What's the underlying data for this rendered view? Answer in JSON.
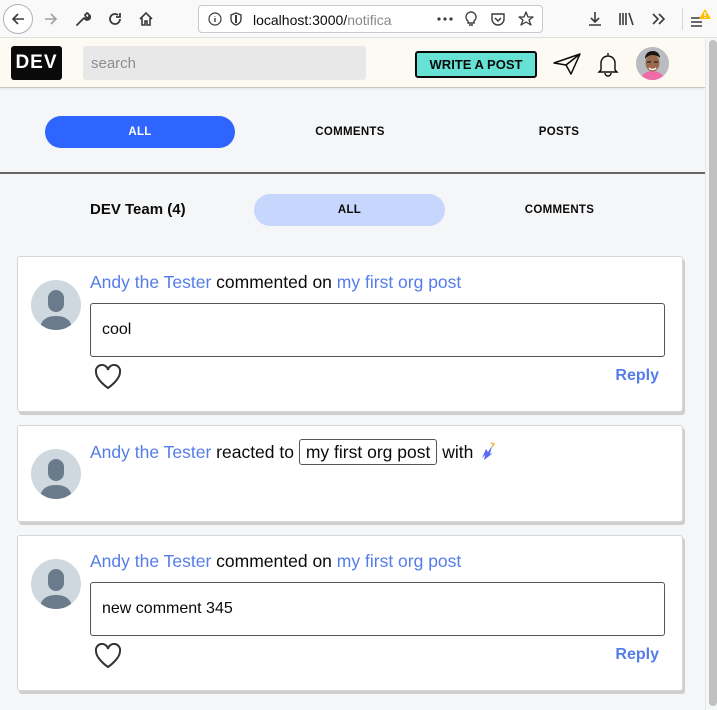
{
  "browser": {
    "url_host": "localhost:3000/",
    "url_path": "notifica",
    "icons": [
      "back-icon",
      "forward-icon",
      "wrench-icon",
      "reload-icon",
      "home-icon",
      "info-icon",
      "shield-icon",
      "more-icon",
      "lightbulb-icon",
      "pocket-icon",
      "star-icon",
      "download-icon",
      "library-icon",
      "overflow-icon",
      "menu-icon"
    ]
  },
  "header": {
    "logo": "DEV",
    "search_placeholder": "search",
    "write_post": "WRITE A POST"
  },
  "tabs": {
    "primary": [
      {
        "label": "ALL",
        "active": true
      },
      {
        "label": "COMMENTS",
        "active": false
      },
      {
        "label": "POSTS",
        "active": false
      }
    ],
    "org_title": "DEV Team (4)",
    "secondary": [
      {
        "label": "ALL",
        "active": true
      },
      {
        "label": "COMMENTS",
        "active": false
      }
    ]
  },
  "notifications": [
    {
      "user": "Andy the Tester",
      "action": "commented on",
      "target": "my first org post",
      "comment": "cool",
      "reply": "Reply"
    },
    {
      "user": "Andy the Tester",
      "action": "reacted to",
      "target": "my first org post",
      "suffix": "with",
      "reaction": "unicorn-icon"
    },
    {
      "user": "Andy the Tester",
      "action": "commented on",
      "target": "my first org post",
      "comment": "new comment 345",
      "reply": "Reply"
    }
  ],
  "colors": {
    "accent_blue": "#2e65ff",
    "link_blue": "#557de8",
    "write_btn": "#66e2d5",
    "tab_light": "#c7d6fc"
  }
}
